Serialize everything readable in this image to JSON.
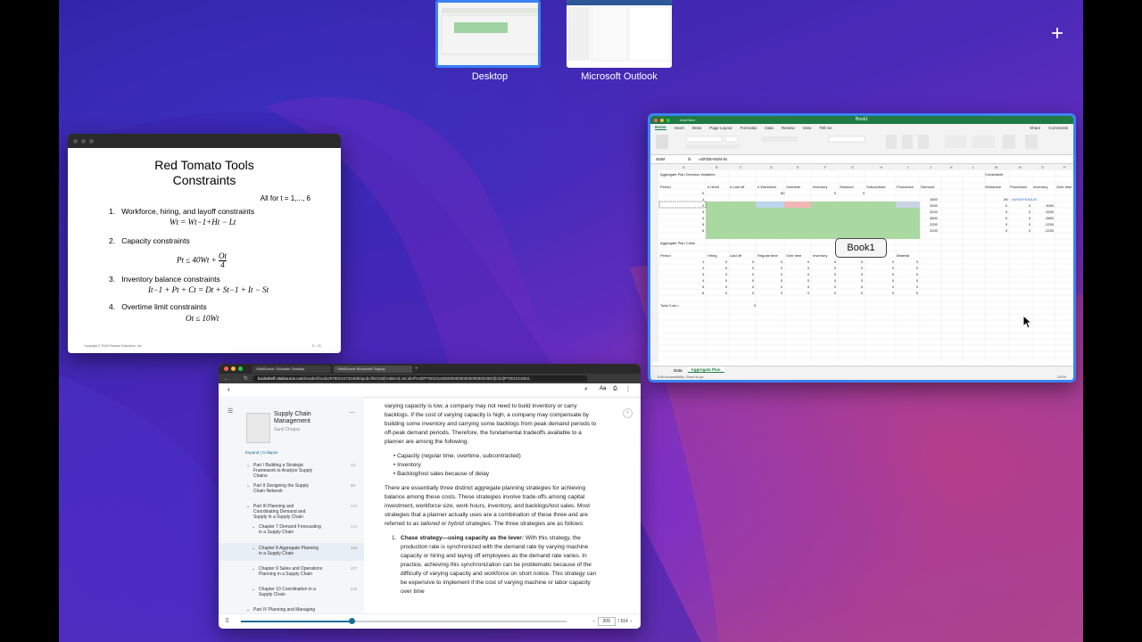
{
  "spaces": {
    "items": [
      {
        "label": "Desktop",
        "active": true
      },
      {
        "label": "Microsoft Outlook",
        "active": false
      }
    ],
    "add_symbol": "+"
  },
  "slide": {
    "title_line1": "Red Tomato Tools",
    "title_line2": "Constraints",
    "all_for": "All for t = 1,..., 6",
    "items": [
      {
        "num": "1.",
        "text": "Workforce, hiring, and layoff constraints",
        "eq": "W_t = W_t−1 + H_t − L_t"
      },
      {
        "num": "2.",
        "text": "Capacity constraints",
        "eq": "P_t ≤ 40W_t + O_t/4"
      },
      {
        "num": "3.",
        "text": "Inventory balance constraints",
        "eq": "I_t−1 + P_t + C_t = D_t + S_t−1 + I_t − S_t"
      },
      {
        "num": "4.",
        "text": "Overtime limit constraints",
        "eq": "O_t ≤ 10W_t"
      }
    ],
    "eq1": "Wt = Wt−1+Ht − Lt",
    "eq2_left": "Pt ≤ 40Wt +",
    "eq2_num": "Ot",
    "eq2_den": "4",
    "eq3": "It−1 + Pt + Ct = Dt + St−1 + It − St",
    "eq4": "Ot ≤ 10Wt",
    "footer": "Copyright © 2016 Pearson Education, Inc.",
    "page": "8 – 21"
  },
  "excel": {
    "title": "Book1",
    "autosave": "AutoSave",
    "tabs": [
      "Home",
      "Insert",
      "Draw",
      "Page Layout",
      "Formulas",
      "Data",
      "Review",
      "View",
      "Tell me"
    ],
    "share": "Share",
    "comments": "Comments",
    "name_box": "SUM",
    "fx": "fx",
    "formula": "=40*D5+E5/4-I5",
    "sheets": [
      "Data",
      "Aggregate Plan"
    ],
    "status": "Edit    Accessibility: Good to go",
    "zoom": "100%",
    "popup": "Book1"
  },
  "browser": {
    "tabs": [
      "VitalSource: Educator Desktop",
      "VitalSource Bookshelf: Supply"
    ],
    "url_host": "bookshelf.vitalsource.com",
    "url_path": "/reader/books/9780134732459/epubcfi/6/160[%3Bvnd.vst.idref%3DP7001014060000000000000000020E0]!/4/2[P7001014063...",
    "book_title": "Supply Chain Management",
    "author": "Sunil Chopra",
    "expand": "Expand",
    "collapse": "Collapse",
    "toc": [
      {
        "label": "Part I Building a Strategic Framework to Analyze Supply Chains",
        "page": "xxi",
        "sub": false
      },
      {
        "label": "Part II Designing the Supply Chain Network",
        "page": "88",
        "sub": false
      },
      {
        "label": "Part III Planning and Coordinating Demand and Supply in a Supply Chain",
        "page": "171",
        "sub": false
      },
      {
        "label": "Chapter 7 Demand Forecasting in a Supply Chain",
        "page": "171",
        "sub": true
      },
      {
        "label": "Chapter 8 Aggregate Planning in a Supply Chain",
        "page": "205",
        "sub": true
      },
      {
        "label": "Chapter 9 Sales and Operations Planning in a Supply Chain",
        "page": "227",
        "sub": true
      },
      {
        "label": "Chapter 10 Coordination in a Supply Chain",
        "page": "244",
        "sub": true
      },
      {
        "label": "Part IV Planning and Managing",
        "page": "",
        "sub": false
      }
    ],
    "para1": "varying capacity is low, a company may not need to build inventory or carry backlogs. If the cost of varying capacity is high, a company may compensate by building some inventory and carrying some backlogs from peak demand periods to off-peak demand periods. Therefore, the fundamental tradeoffs available to a planner are among the following:",
    "bullets": [
      "Capacity (regular time, overtime, subcontracted)",
      "Inventory",
      "Backlog/lost sales because of delay"
    ],
    "para2_a": "There are essentially three distinct aggregate planning strategies for achieving balance among these costs. These strategies involve trade-offs among capital investment, workforce size, work hours, inventory, and backlogs/lost sales. Most strategies that a planner actually uses are a combination of these three and are referred to as ",
    "para2_em": "tailored or hybrid strategies",
    "para2_b": ". The three strategies are as follows:",
    "list_item_bold": "Chase strategy—using capacity as the lever:",
    "list_item_text": " With this strategy, the production rate is synchronized with the demand rate by varying machine capacity or hiring and laying off employees as the demand rate varies. In practice, achieving this synchronization can be problematic because of the difficulty of varying capacity and workforce on short notice. This strategy can be expensive to implement if the cost of varying machine or labor capacity over time",
    "list_num": "1.",
    "current_page": "209",
    "total_pages": "/ 514",
    "progress": 0.34
  }
}
